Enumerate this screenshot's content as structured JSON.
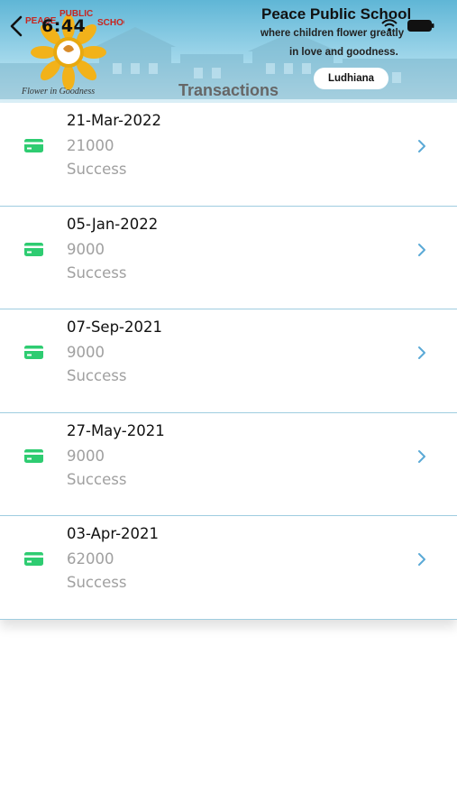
{
  "status_bar": {
    "time": "6:44"
  },
  "header": {
    "logo_text_top": "PEACE PUBLIC SCHOOL",
    "logo_text_script": "Flower in Goodness",
    "school_name": "Peace Public School",
    "tagline_line1": "where children flower greatly",
    "tagline_line2": "in love and goodness.",
    "city": "Ludhiana",
    "title": "Transactions"
  },
  "colors": {
    "accent": "#5fb3d6",
    "icon_green": "#2ecc71",
    "chevron": "#5aa9d6",
    "divider": "#9fcde0"
  },
  "transactions": [
    {
      "date": "21-Mar-2022",
      "amount": "21000",
      "status": "Success",
      "icon": "credit-card-icon"
    },
    {
      "date": "05-Jan-2022",
      "amount": "9000",
      "status": "Success",
      "icon": "credit-card-icon"
    },
    {
      "date": "07-Sep-2021",
      "amount": "9000",
      "status": "Success",
      "icon": "credit-card-icon"
    },
    {
      "date": "27-May-2021",
      "amount": "9000",
      "status": "Success",
      "icon": "credit-card-icon"
    },
    {
      "date": "03-Apr-2021",
      "amount": "62000",
      "status": "Success",
      "icon": "credit-card-icon"
    }
  ]
}
